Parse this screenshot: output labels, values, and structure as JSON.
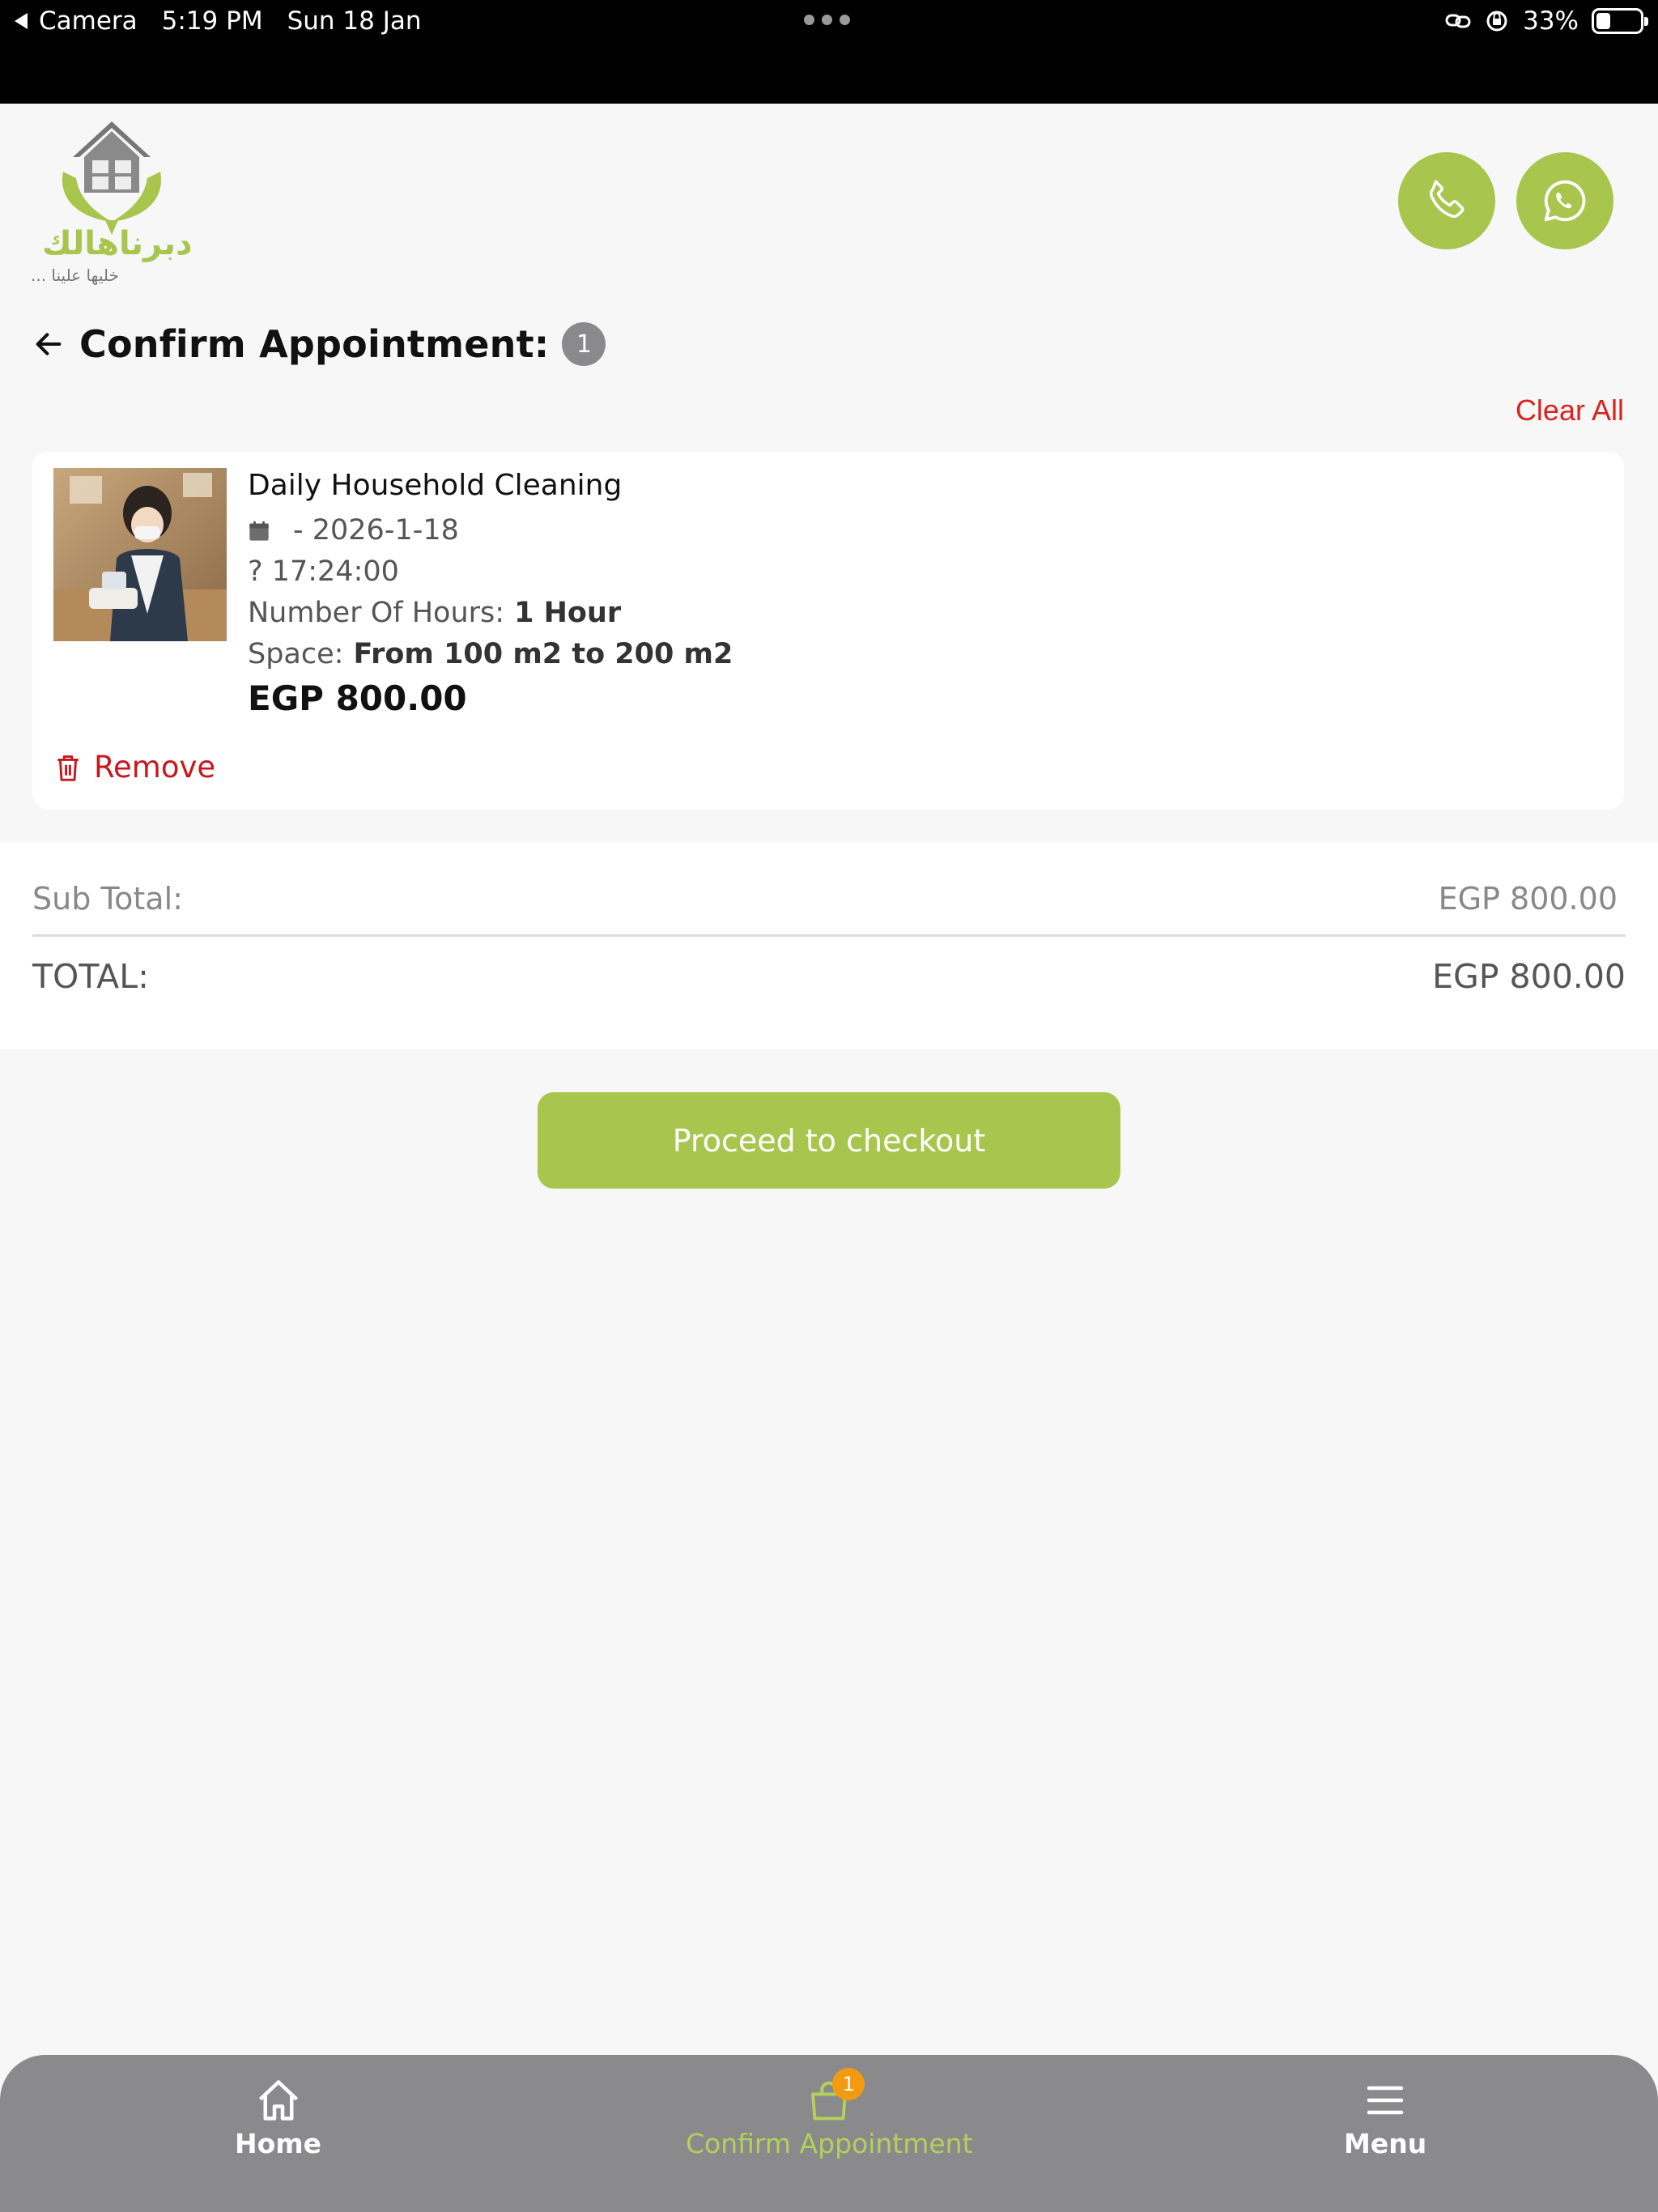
{
  "status_bar": {
    "back_app": "Camera",
    "time": "5:19 PM",
    "date": "Sun 18 Jan",
    "battery": "33%",
    "battery_level": 0.33
  },
  "logo": {
    "arabic_name": "دبرناهالك",
    "tagline": "خليها علينا ..."
  },
  "header": {
    "call_icon": "phone-icon",
    "whatsapp_icon": "whatsapp-icon"
  },
  "page": {
    "title": "Confirm Appointment:",
    "count": "1",
    "clear_all": "Clear All"
  },
  "item": {
    "name": "Daily Household Cleaning",
    "date": "- 2026-1-18",
    "time": "? 17:24:00",
    "hours_label": "Number Of Hours:",
    "hours_value": "1 Hour",
    "space_label": "Space:",
    "space_value": "From 100 m2 to 200 m2",
    "price": "EGP 800.00",
    "remove_label": "Remove"
  },
  "totals": {
    "subtotal_label": "Sub Total:",
    "subtotal_value": "EGP 800.00",
    "total_label": "TOTAL:",
    "total_value": "EGP 800.00"
  },
  "checkout_label": "Proceed to checkout",
  "bottom_nav": {
    "items": [
      {
        "label": "Home",
        "icon": "home-icon"
      },
      {
        "label": "Confirm Appointment",
        "icon": "bag-icon",
        "badge": "1",
        "active": true
      },
      {
        "label": "Menu",
        "icon": "menu-icon"
      }
    ]
  },
  "colors": {
    "accent": "#a8c64e",
    "danger": "#d8231f",
    "nav_bg": "#8a8a8d",
    "badge": "#f29b11"
  }
}
